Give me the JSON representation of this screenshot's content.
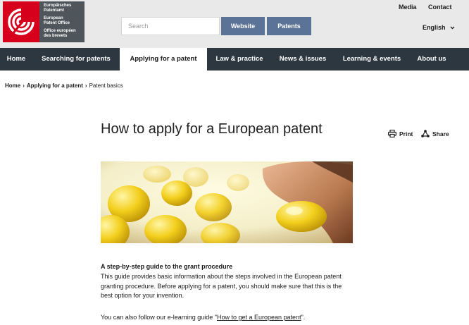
{
  "header": {
    "logo_lines_1": [
      "Europäisches",
      "Patentamt"
    ],
    "logo_lines_2": [
      "European",
      "Patent Office"
    ],
    "logo_lines_3": [
      "Office européen",
      "des brevets"
    ],
    "search_placeholder": "Search",
    "scope_buttons": [
      "Website",
      "Patents"
    ],
    "utility_links": [
      "Media",
      "Contact"
    ],
    "language": "English"
  },
  "nav": {
    "items": [
      "Home",
      "Searching for patents",
      "Applying for a patent",
      "Law & practice",
      "News & issues",
      "Learning & events",
      "About us"
    ],
    "active": "Applying for a patent"
  },
  "breadcrumb": {
    "items": [
      "Home",
      "Applying for a patent",
      "Patent basics"
    ]
  },
  "page": {
    "title": "How to apply for a European patent",
    "print_label": "Print",
    "share_label": "Share",
    "lead_title": "A step-by-step guide to the grant procedure",
    "lead_body": "This guide provides basic information about the steps involved in the European patent granting procedure. Before applying for a patent, you should make sure that this is the best option for your invention.",
    "elearn_prefix": "You can also follow our e-learning guide \"",
    "elearn_link": "How to get a European patent",
    "elearn_suffix": "\"."
  },
  "colors": {
    "logo_red": "#d6001c",
    "nav_bg": "#2d3740",
    "scope_btn": "#5a7396",
    "header_bg": "#e9e9ea"
  }
}
